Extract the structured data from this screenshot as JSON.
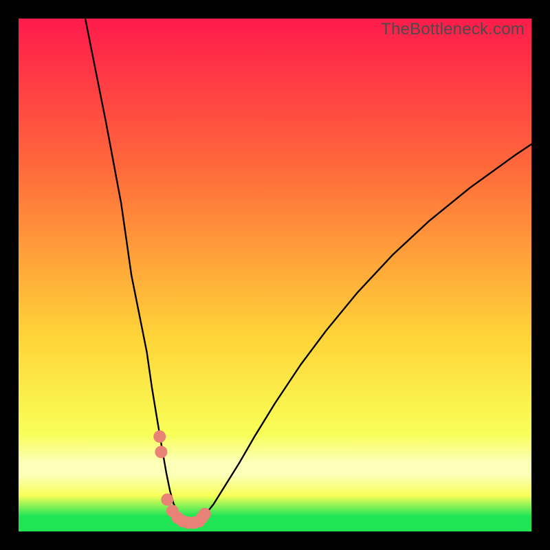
{
  "watermark": "TheBottleneck.com",
  "colors": {
    "bg_black": "#000000",
    "grad_top": "#ff1b4b",
    "grad_mid1": "#ff663b",
    "grad_mid2": "#ffd438",
    "grad_mid3": "#f8ff57",
    "grad_band_pale": "#fbffb8",
    "grad_green": "#1fe555",
    "curve_stroke": "#000000",
    "marker_fill": "#e88277"
  },
  "chart_data": {
    "type": "line",
    "title": "",
    "xlabel": "",
    "ylabel": "",
    "xlim": [
      0,
      100
    ],
    "ylim": [
      0,
      100
    ],
    "series": [
      {
        "name": "bottleneck-curve",
        "x": [
          13,
          15,
          17,
          18.5,
          20,
          21,
          22,
          23.5,
          25,
          26,
          27,
          28,
          28.8,
          29.5,
          30.2,
          31,
          32,
          33,
          34,
          35,
          36,
          38,
          40,
          43,
          46,
          50,
          55,
          60,
          66,
          73,
          80,
          88,
          97,
          100
        ],
        "y": [
          100,
          90,
          80,
          72,
          64,
          57,
          50,
          42.5,
          35,
          28,
          22,
          16,
          11.5,
          8,
          5.5,
          3.7,
          2.4,
          1.7,
          1.6,
          1.9,
          2.8,
          5.3,
          8.5,
          13.3,
          18.5,
          25,
          32.5,
          39.2,
          46.5,
          54,
          60.5,
          67,
          73.5,
          75.5
        ]
      }
    ],
    "markers": {
      "name": "highlight-points",
      "x": [
        27.5,
        27.8,
        29.0,
        30.0,
        31.0,
        32.0,
        33.1,
        34.2,
        35.2,
        35.8,
        36.3
      ],
      "y": [
        18.5,
        15.5,
        6.2,
        4.0,
        2.7,
        2.0,
        1.7,
        1.7,
        2.0,
        2.7,
        3.4
      ]
    }
  }
}
